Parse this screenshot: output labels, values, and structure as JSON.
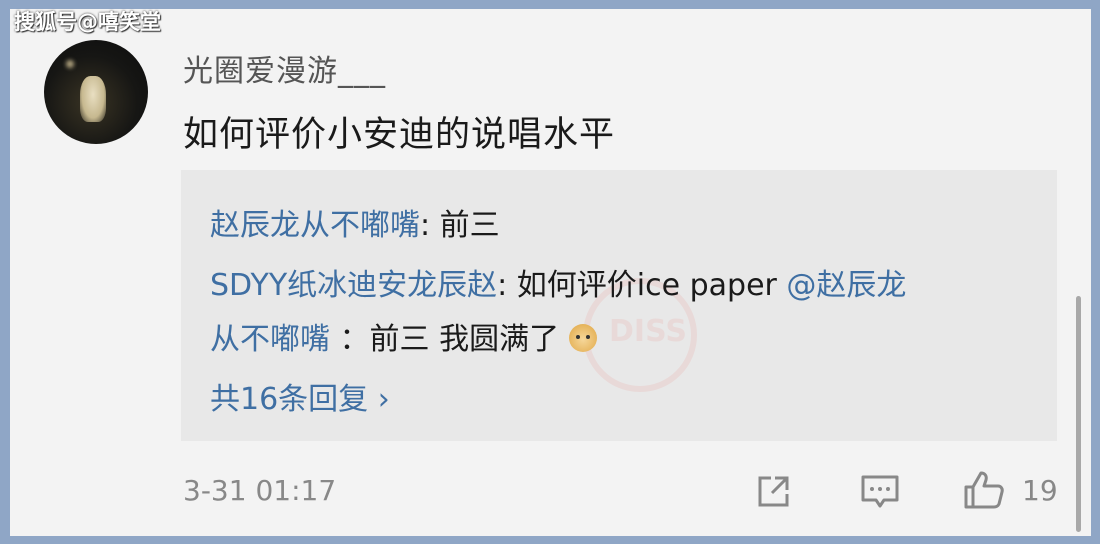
{
  "watermark": "搜狐号@嘻笑堂",
  "post": {
    "username": "光圈爱漫游___",
    "comment": "如何评价小安迪的说唱水平"
  },
  "seal": {
    "text": "DISS"
  },
  "replies": [
    {
      "author": "赵辰龙从不嘟嘴",
      "text": ": 前三"
    },
    {
      "author": "SDYY纸冰迪安龙辰赵",
      "text": ": 如何评价ice paper ",
      "mention": "@赵辰龙"
    },
    {
      "mention_cont": "从不嘟嘴",
      "text": " ：前三   我圆满了"
    }
  ],
  "more_replies": "共16条回复 ›",
  "footer": {
    "timestamp": "3-31 01:17",
    "like_count": "19"
  },
  "icons": [
    "share-icon",
    "comment-icon",
    "like-icon",
    "doge-emoji-icon"
  ],
  "colors": {
    "link": "#3f6fa3",
    "text": "#1a1a1a",
    "meta": "#888888",
    "reply_bg": "#e8e8e8"
  }
}
